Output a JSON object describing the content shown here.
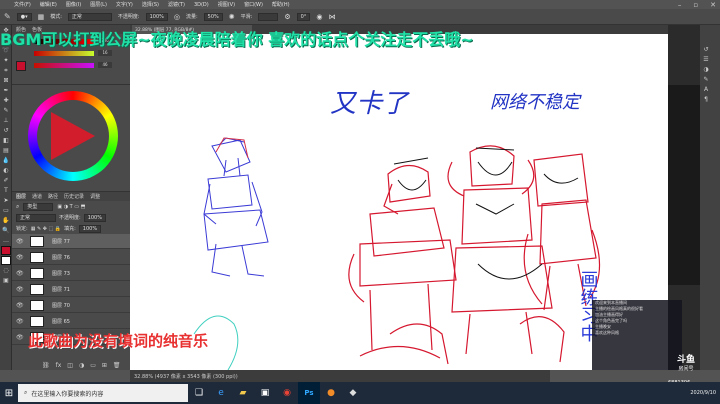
{
  "menubar": {
    "items": [
      "文件(F)",
      "编辑(E)",
      "图像(I)",
      "图层(L)",
      "文字(Y)",
      "选择(S)",
      "滤镜(T)",
      "3D(D)",
      "视图(V)",
      "窗口(W)",
      "帮助(H)"
    ]
  },
  "options": {
    "mode_label": "模式:",
    "mode_value": "正常",
    "opacity_label": "不透明度:",
    "opacity_value": "100%",
    "flow_label": "流量:",
    "flow_value": "50%",
    "smooth_label": "平滑:",
    "angle_value": "0°"
  },
  "color_panel": {
    "r_value": "200",
    "g_value": "16",
    "b_value": "46",
    "fg_color": "#c8102e"
  },
  "layers_panel": {
    "tabs": [
      "图层",
      "通道",
      "路径",
      "历史记录",
      "调整"
    ],
    "kind_label": "类型",
    "blend_mode": "正常",
    "opacity_label": "不透明度:",
    "opacity_value": "100%",
    "fill_label": "填充:",
    "fill_value": "100%",
    "layers": [
      {
        "name": "图层 77",
        "selected": true
      },
      {
        "name": "图层 76",
        "selected": false
      },
      {
        "name": "图层 73",
        "selected": false
      },
      {
        "name": "图层 71",
        "selected": false
      },
      {
        "name": "图层 70",
        "selected": false
      },
      {
        "name": "图层 65",
        "selected": false
      },
      {
        "name": "图层 64",
        "selected": false
      }
    ]
  },
  "document": {
    "tab_label": "32.88% (图层 77, RGB/8#)",
    "status": "32.88%   (4937 像素 x 3543 像素 (300 ppi))"
  },
  "canvas_text": {
    "handwriting_1": "又卡了",
    "handwriting_2": "网络不稳定",
    "vertical_note": "画练习中"
  },
  "overlay": {
    "banner": "BGM可以打到公屏~夜晚凌晨陪着你 喜欢的话点个关注走不丢哦~",
    "subtitle": "此歌曲为没有填词的纯音乐"
  },
  "stream": {
    "logo": "斗鱼",
    "room": "房间号",
    "room_id": "6881306",
    "chat": [
      "欢迎来到本直播间",
      "主播的绘画风格真的很好看",
      "加油主播画得好",
      "这个角色画完了吗",
      "主播晚安",
      "喜欢这种风格"
    ]
  },
  "taskbar": {
    "search_placeholder": "在这里输入你要搜索的内容",
    "time": "",
    "date": "2020/9/10",
    "apps": [
      "task-view-icon",
      "edge-icon",
      "folder-icon",
      "store-icon",
      "chrome-icon",
      "photoshop-icon",
      "app-icon",
      "app-icon"
    ]
  }
}
